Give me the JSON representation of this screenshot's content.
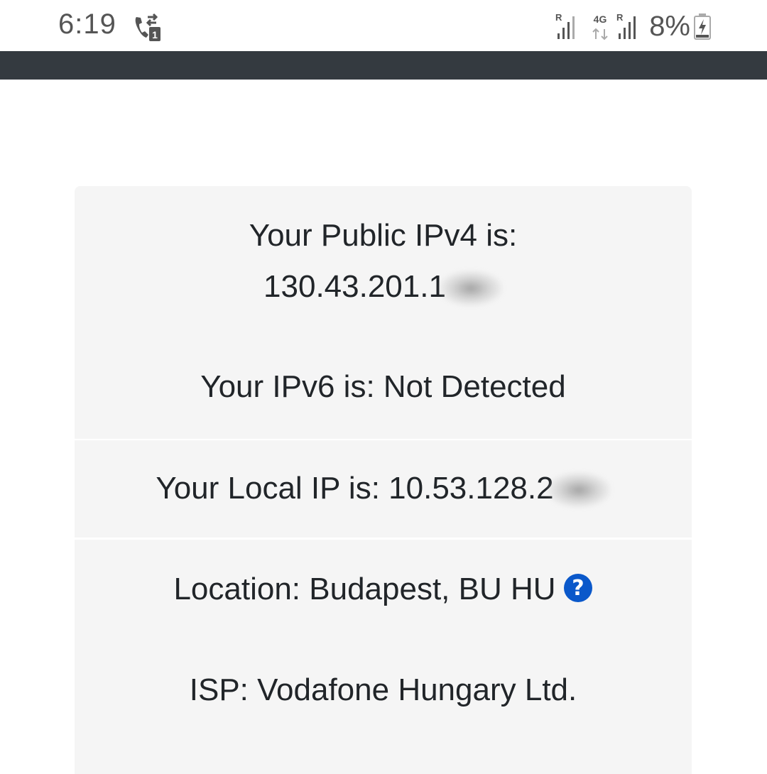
{
  "status_bar": {
    "time": "6:19",
    "network_type": "4G",
    "roaming_marker": "R",
    "battery_percent": "8%",
    "icons": [
      "call-forward-sim1-icon",
      "signal-icon",
      "network-4g-icon",
      "signal-icon",
      "battery-charging-icon"
    ]
  },
  "colors": {
    "nav_bar": "#343a40",
    "card_bg": "#f5f5f5",
    "help_icon": "#0a58ca",
    "text": "#212529"
  },
  "info": {
    "ipv4_label": "Your Public IPv4 is:",
    "ipv4_value": "130.43.201.1",
    "ipv6_text": "Your IPv6 is: Not Detected",
    "local_ip_text": "Your Local IP is: 10.53.128.2",
    "location_text": "Location: Budapest, BU HU",
    "help_icon": "question-circle-icon",
    "isp_text": "ISP: Vodafone Hungary Ltd."
  }
}
